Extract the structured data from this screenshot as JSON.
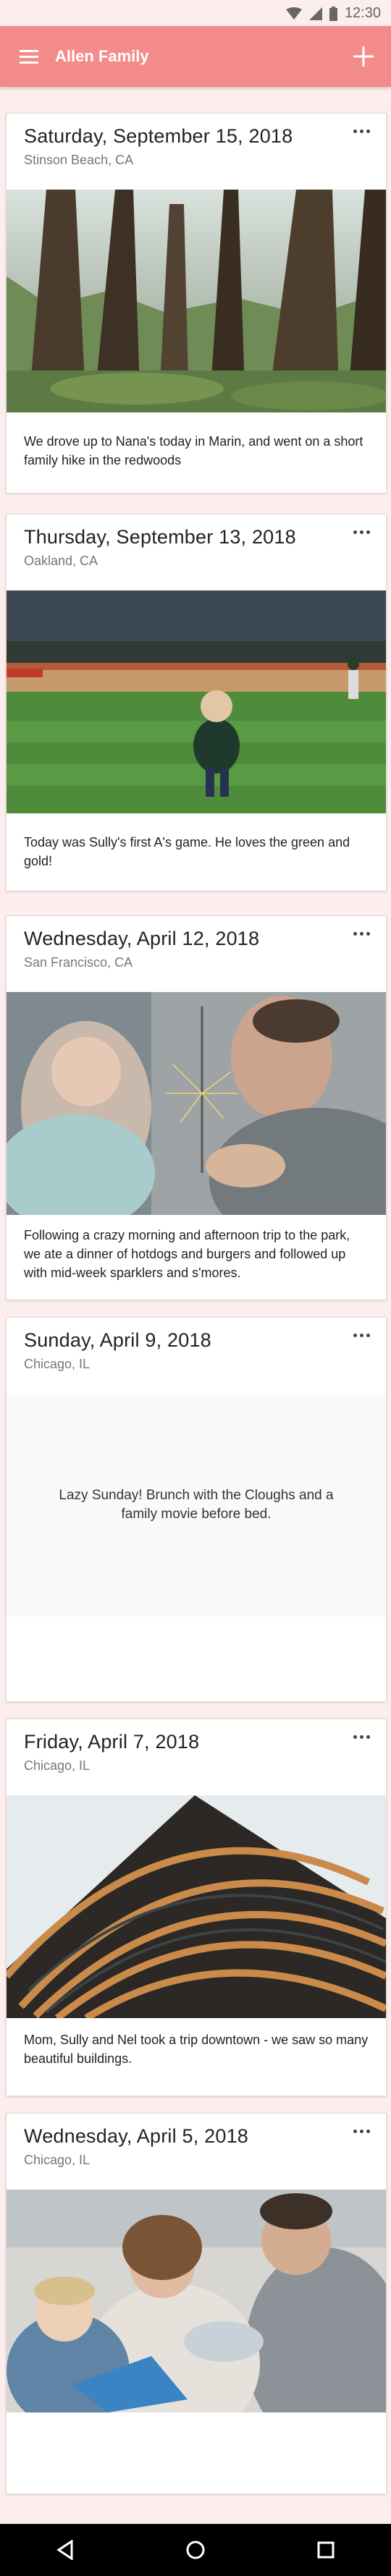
{
  "status_bar": {
    "time": "12:30",
    "icons": [
      "wifi-icon",
      "signal-icon",
      "battery-icon"
    ]
  },
  "app_bar": {
    "title": "Allen Family",
    "menu_icon": "menu-icon",
    "add_icon": "add-icon",
    "color": "#f48b8b"
  },
  "posts": [
    {
      "date": "Saturday, September 15, 2018",
      "location": "Stinson Beach, CA",
      "caption": "We drove up to Nana's today in Marin, and went on a short family hike in the redwoods",
      "image": "redwood forest photo"
    },
    {
      "date": "Thursday, September 13, 2018",
      "location": "Oakland, CA",
      "caption": "Today was Sully's first A's game.  He loves the green and gold!",
      "image": "toddler on baseball field photo"
    },
    {
      "date": "Wednesday, April 12, 2018",
      "location": "San Francisco, CA",
      "caption": "Following a crazy morning and afternoon trip to the park, we ate a dinner of hotdogs and burgers and followed up with mid-week sparklers and s'mores.",
      "image": "father and child with sparkler photo"
    },
    {
      "date": "Sunday, April 9, 2018",
      "location": "Chicago, IL",
      "caption": "Lazy Sunday! Brunch with the Cloughs and a family movie before bed."
    },
    {
      "date": "Friday, April 7, 2018",
      "location": "Chicago, IL",
      "caption": "Mom, Sully and Nel took a trip downtown - we saw so many beautiful buildings.",
      "image": "curved building facade photo"
    },
    {
      "date": "Wednesday, April 5, 2018",
      "location": "Chicago, IL",
      "image": "family reading a book photo"
    }
  ],
  "nav_bar": {
    "buttons": [
      "back-icon",
      "home-icon",
      "recents-icon"
    ]
  }
}
